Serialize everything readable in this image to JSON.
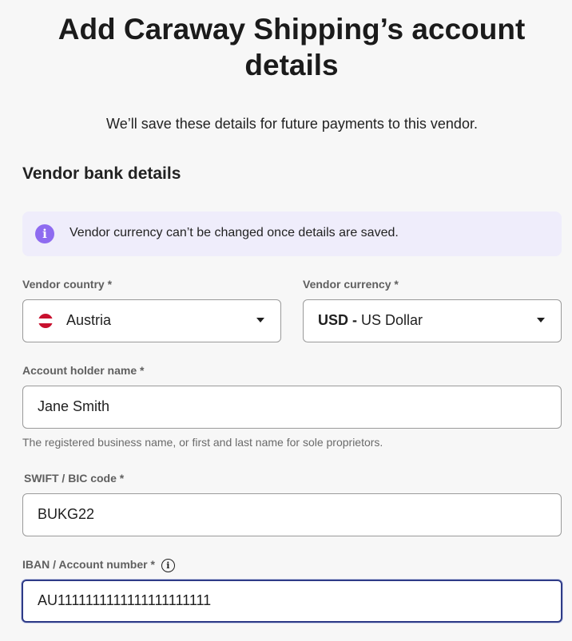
{
  "header": {
    "title": "Add Caraway Shipping’s account details",
    "subtitle": "We’ll save these details for future payments to this vendor."
  },
  "section": {
    "title": "Vendor bank details"
  },
  "notice": {
    "icon": "info-icon",
    "text": "Vendor currency can’t be changed once details are saved."
  },
  "fields": {
    "country": {
      "label": "Vendor country *",
      "value": "Austria",
      "flag": "austria-flag"
    },
    "currency": {
      "label": "Vendor currency *",
      "code": "USD -",
      "name": "US Dollar"
    },
    "holder": {
      "label": "Account holder name *",
      "value": "Jane Smith",
      "helper": "The registered business name, or first and last name for sole proprietors."
    },
    "swift": {
      "label": "SWIFT / BIC code *",
      "value": "BUKG22"
    },
    "iban": {
      "label": "IBAN / Account number *",
      "value": "AU1111111111111111111111"
    }
  },
  "colors": {
    "accent": "#8e6bf0",
    "notice_bg": "#efedfb",
    "focus_border": "#2e3b87"
  }
}
